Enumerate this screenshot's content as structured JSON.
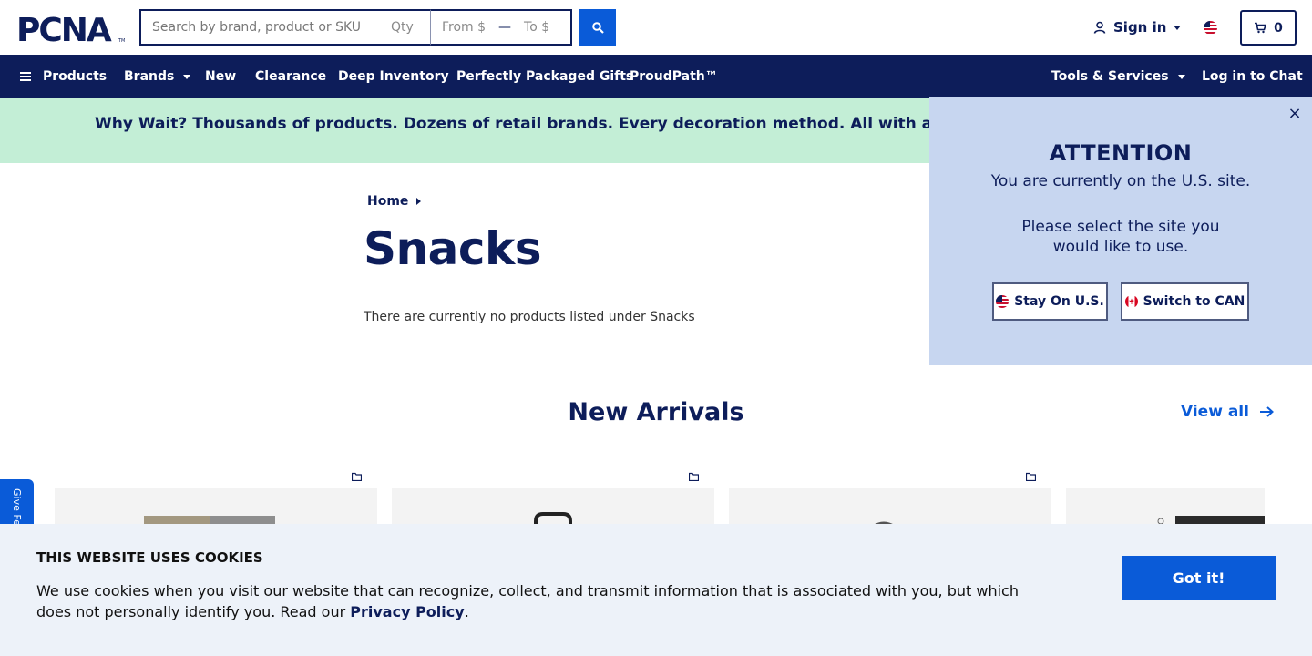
{
  "header": {
    "logo_text": "PCNA",
    "search_placeholder": "Search by brand, product or SKU",
    "qty_placeholder": "Qty",
    "price_from_placeholder": "From $",
    "price_to_placeholder": "To $",
    "price_separator": "—",
    "signin_label": "Sign in",
    "cart_count": "0"
  },
  "nav": {
    "products": "Products",
    "brands": "Brands",
    "new": "New",
    "clearance": "Clearance",
    "deep_inventory": "Deep Inventory",
    "gifts": "Perfectly Packaged Gifts",
    "proudpath": "ProudPath™",
    "tools": "Tools & Services",
    "chat": "Log in to Chat"
  },
  "banner": {
    "text": "Why Wait? Thousands of products. Dozens of retail brands. Every decoration method. All with a standard"
  },
  "main": {
    "breadcrumb_home": "Home",
    "title": "Snacks",
    "empty_message": "There are currently no products listed under Snacks",
    "section_title": "New Arrivals",
    "view_all": "View all"
  },
  "feedback": {
    "label": "Give Fe"
  },
  "cookie": {
    "title": "THIS WEBSITE USES COOKIES",
    "text": "We use cookies when you visit our website that can recognize, collect, and transmit information that is associated with you, but which does not personally identify you. Read our",
    "link": "Privacy Policy",
    "period": ".",
    "button": "Got it!"
  },
  "popup": {
    "close": "×",
    "title": "ATTENTION",
    "line1": "You are currently on the U.S. site.",
    "line2": "Please select the site you",
    "line3": "would like to use.",
    "stay_button": "Stay On U.S.",
    "switch_button": "Switch to CAN"
  },
  "colors": {
    "navy": "#0d1d5a",
    "accent_blue": "#0a5bd8",
    "banner_green": "#c3eed6",
    "popup_bg": "#c7d6f0",
    "cookie_bg": "#edf2f9"
  }
}
